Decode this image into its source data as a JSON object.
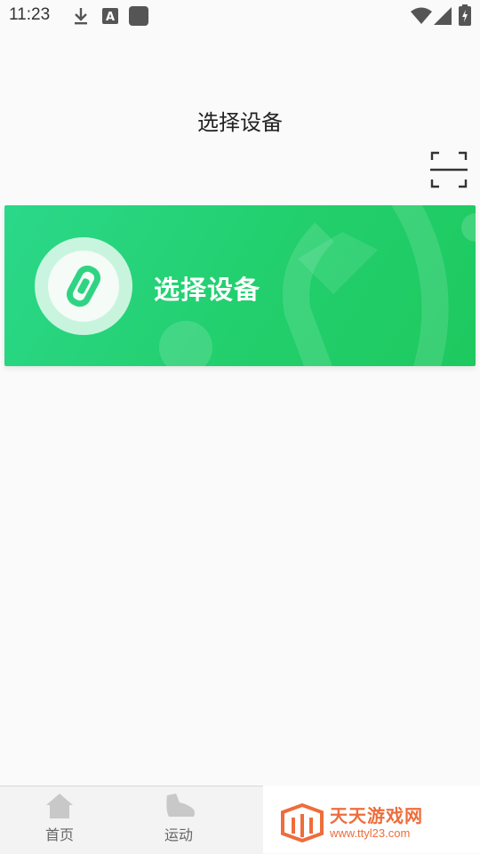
{
  "status_bar": {
    "time": "11:23",
    "icons": [
      "download-icon",
      "font-a-icon",
      "app-square-icon",
      "wifi-icon",
      "signal-icon",
      "battery-icon"
    ]
  },
  "header": {
    "title": "选择设备",
    "scan_icon": "scan-icon"
  },
  "device_card": {
    "label": "选择设备",
    "icon": "band-icon",
    "colors": {
      "start": "#2bd88a",
      "end": "#1ec95f"
    }
  },
  "bottom_nav": {
    "items": [
      {
        "label": "首页",
        "icon": "home-icon"
      },
      {
        "label": "运动",
        "icon": "shoe-icon"
      }
    ]
  },
  "watermark": {
    "title": "天天游戏网",
    "url": "www.ttyl23.com",
    "color": "#ee6d3b"
  }
}
